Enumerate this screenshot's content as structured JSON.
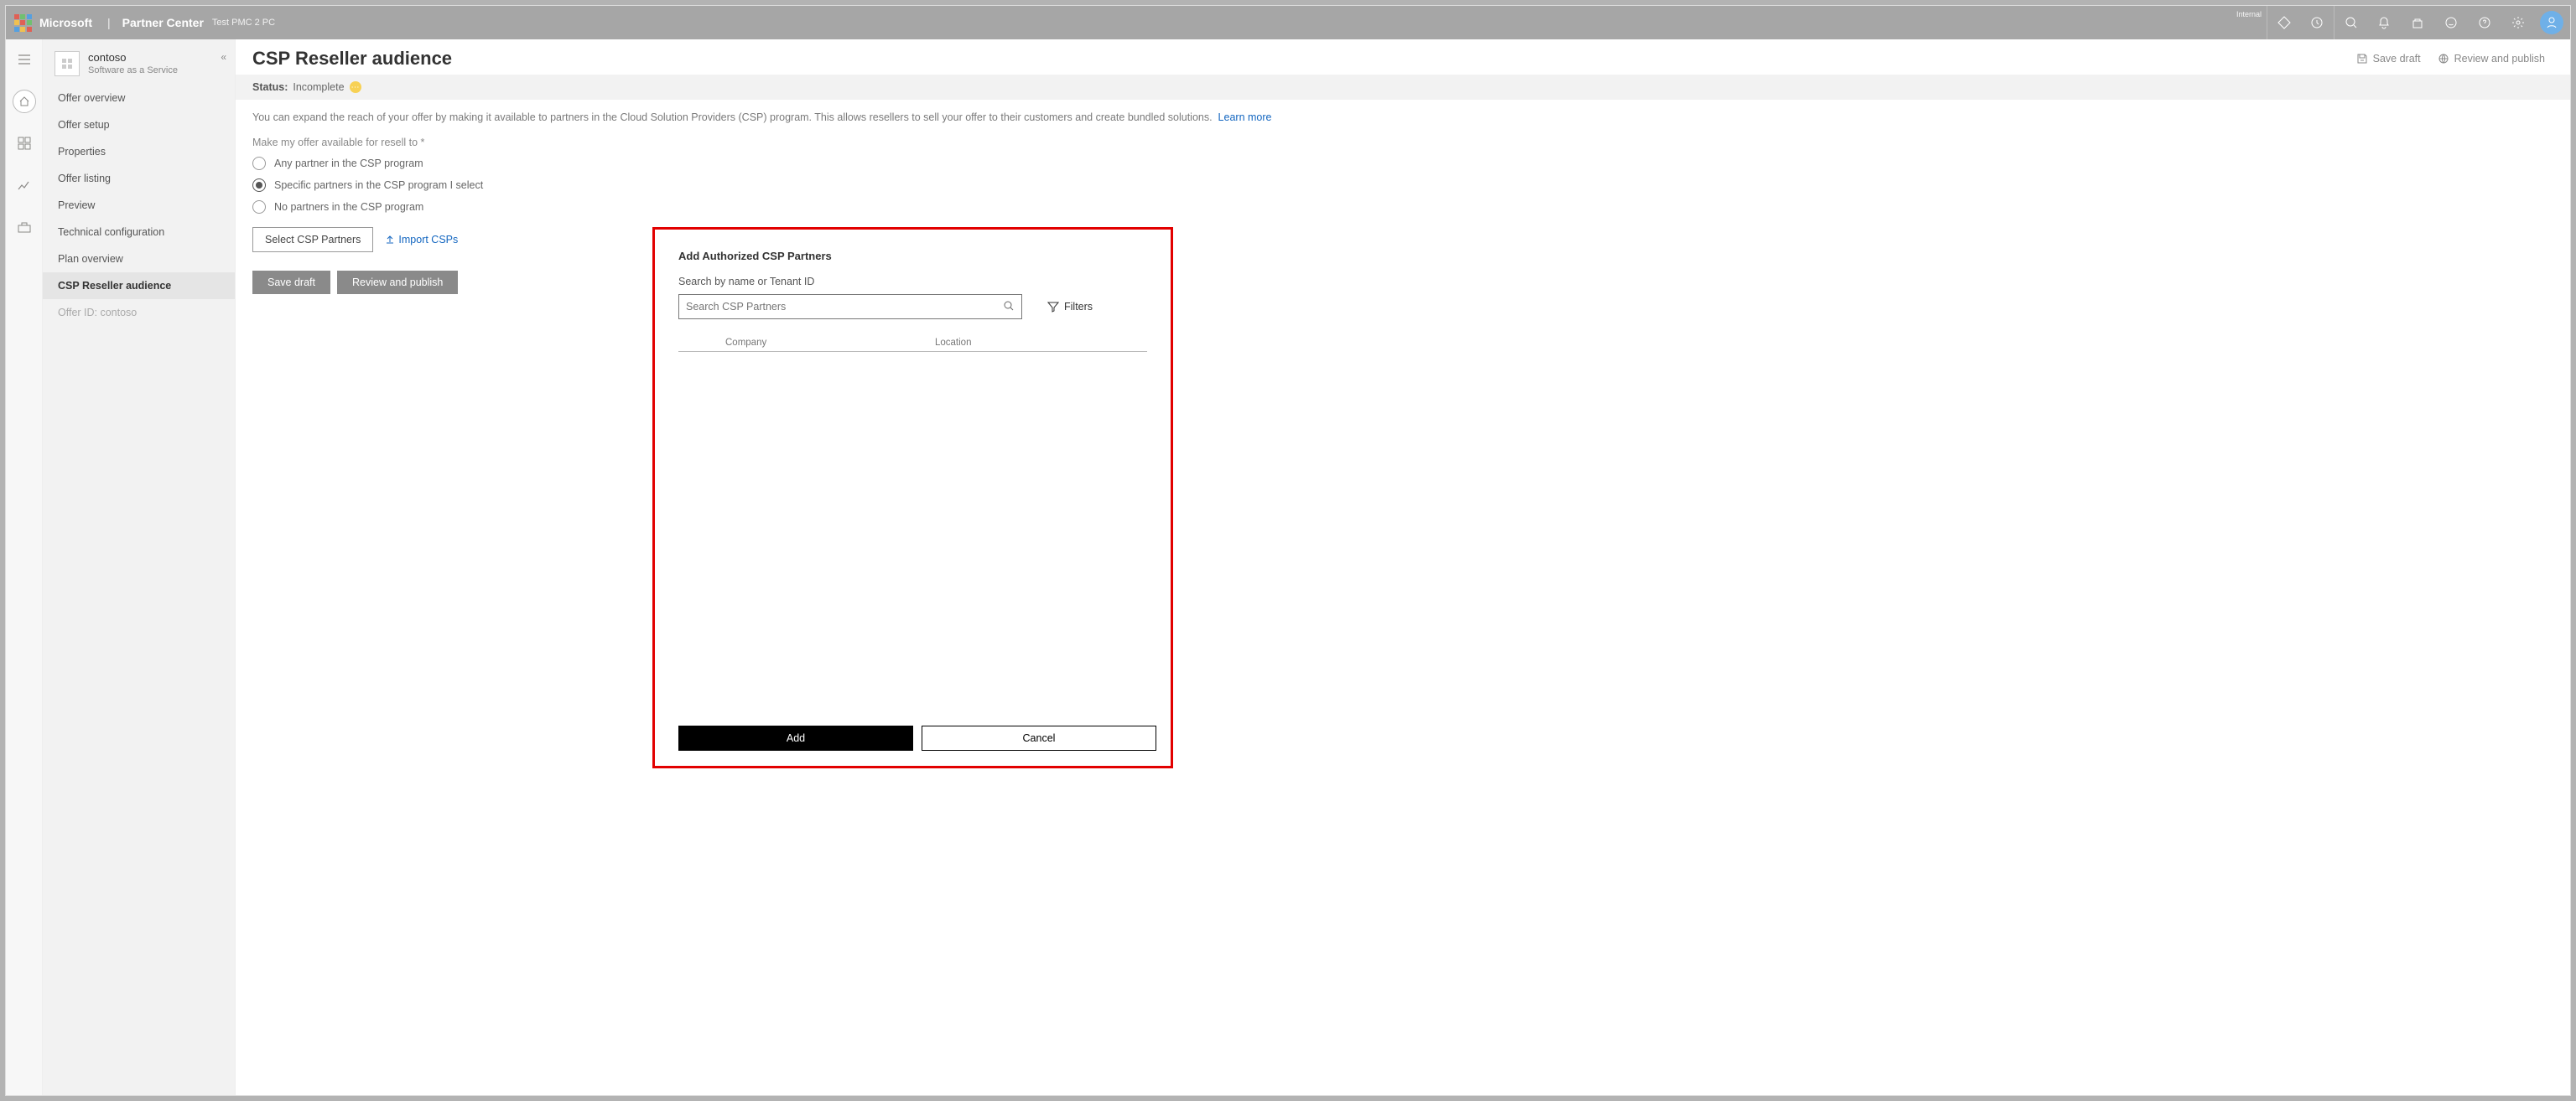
{
  "topbar": {
    "brand": "Microsoft",
    "divider": "|",
    "product": "Partner Center",
    "env": "Test PMC 2 PC",
    "internal_label": "Internal",
    "avatar_initial": ""
  },
  "offer": {
    "name": "contoso",
    "subtitle": "Software as a Service"
  },
  "nav": {
    "items": [
      "Offer overview",
      "Offer setup",
      "Properties",
      "Offer listing",
      "Preview",
      "Technical configuration",
      "Plan overview",
      "CSP Reseller audience"
    ],
    "muted": "Offer ID: contoso"
  },
  "page": {
    "title": "CSP Reseller audience",
    "save_draft": "Save draft",
    "review_publish": "Review and publish",
    "status_label": "Status:",
    "status_value": "Incomplete",
    "help": "You can expand the reach of your offer by making it available to partners in the Cloud Solution Providers (CSP) program. This allows resellers to sell your offer to their customers and create bundled solutions.",
    "learn_more": "Learn more",
    "field_label": "Make my offer available for resell to *",
    "radios": {
      "any": "Any partner in the CSP program",
      "specific": "Specific partners in the CSP program I select",
      "none": "No partners in the CSP program"
    },
    "select_csp": "Select CSP Partners",
    "import_csps": "Import CSPs",
    "footer_save": "Save draft",
    "footer_review": "Review and publish"
  },
  "dialog": {
    "title": "Add Authorized CSP Partners",
    "subtitle": "Search by name or Tenant ID",
    "search_placeholder": "Search CSP Partners",
    "filters": "Filters",
    "col_company": "Company",
    "col_location": "Location",
    "add": "Add",
    "cancel": "Cancel"
  }
}
